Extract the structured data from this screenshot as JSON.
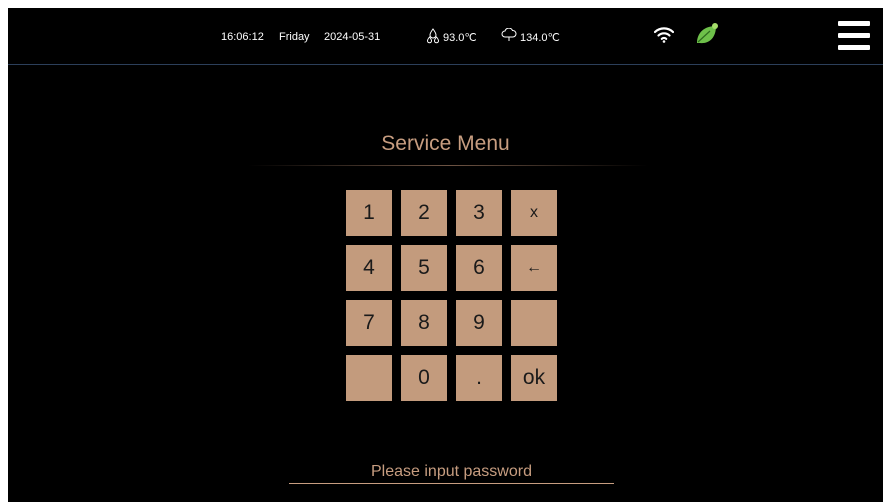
{
  "status_bar": {
    "time": "16:06:12",
    "day": "Friday",
    "date": "2024-05-31",
    "temp1": "93.0℃",
    "temp1_icon": "water-drops-icon",
    "temp2": "134.0℃",
    "temp2_icon": "steam-cloud-icon",
    "wifi_icon": "wifi-icon",
    "eco_icon": "leaf-icon",
    "menu_icon": "hamburger-menu-icon"
  },
  "title": "Service Menu",
  "keypad": {
    "keys": [
      "1",
      "2",
      "3",
      "x",
      "4",
      "5",
      "6",
      "←",
      "7",
      "8",
      "9",
      "",
      "",
      "0",
      ".",
      "ok"
    ]
  },
  "password": {
    "placeholder": "Please input password"
  },
  "colors": {
    "background": "#000000",
    "key_fill": "#c39b7d",
    "accent_text": "#c79d80",
    "eco_green": "#6ec04a"
  }
}
